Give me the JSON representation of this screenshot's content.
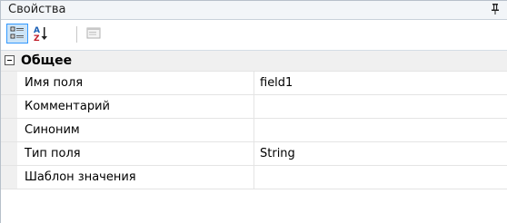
{
  "panel": {
    "title": "Свойства",
    "pin_icon": "pin-icon"
  },
  "toolbar": {
    "buttons": [
      {
        "name": "categorized-view-button",
        "icon": "categorized-icon",
        "active": true
      },
      {
        "name": "alphabetical-sort-button",
        "icon": "sort-az-icon",
        "active": false
      },
      {
        "name": "property-pages-button",
        "icon": "property-pages-icon",
        "active": false,
        "disabled": true
      }
    ]
  },
  "grid": {
    "category": {
      "label": "Общее",
      "expanded": true
    },
    "properties": [
      {
        "name": "Имя поля",
        "value": "field1"
      },
      {
        "name": "Комментарий",
        "value": ""
      },
      {
        "name": "Синоним",
        "value": ""
      },
      {
        "name": "Тип поля",
        "value": "String"
      },
      {
        "name": "Шаблон значения",
        "value": ""
      }
    ]
  },
  "colors": {
    "titlebar_bg": "#f2f5f8",
    "selected_button_border": "#3399ff",
    "selected_button_bg": "#cce4f7",
    "category_bg": "#f0f0f0"
  }
}
